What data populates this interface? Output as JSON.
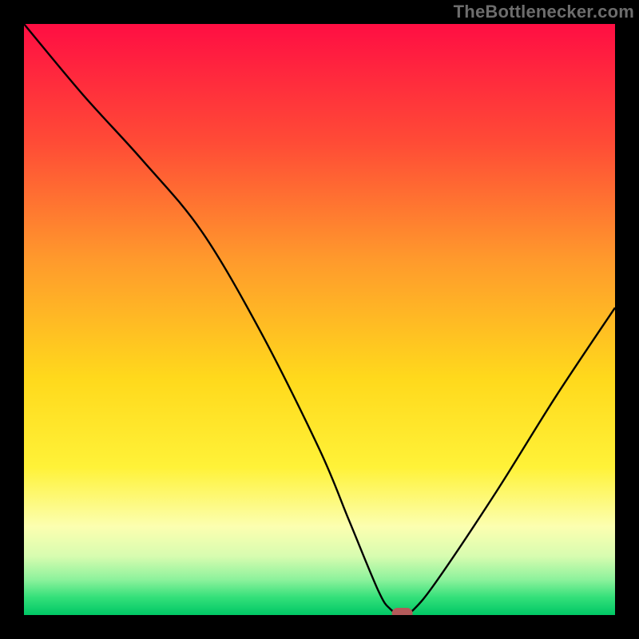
{
  "attribution": "TheBottleneсker.com",
  "chart_data": {
    "type": "line",
    "title": "",
    "xlabel": "",
    "ylabel": "",
    "xlim": [
      0,
      100
    ],
    "ylim": [
      0,
      100
    ],
    "x": [
      0,
      10,
      20,
      30,
      40,
      50,
      55,
      60,
      62,
      64,
      66,
      70,
      80,
      90,
      100
    ],
    "values": [
      100,
      88,
      77,
      65,
      48,
      28,
      16,
      4,
      1,
      0,
      1,
      6,
      21,
      37,
      52
    ],
    "curve_color": "#000000",
    "marker": {
      "x": 64,
      "y": 0,
      "color": "#b45a5a"
    },
    "background_gradient_stops": [
      {
        "pct": 0.0,
        "color": "#ff0e43"
      },
      {
        "pct": 0.2,
        "color": "#ff4b36"
      },
      {
        "pct": 0.4,
        "color": "#ff9a2c"
      },
      {
        "pct": 0.6,
        "color": "#ffd91c"
      },
      {
        "pct": 0.75,
        "color": "#fff238"
      },
      {
        "pct": 0.85,
        "color": "#fcffb0"
      },
      {
        "pct": 0.9,
        "color": "#d8fcb0"
      },
      {
        "pct": 0.94,
        "color": "#8df29c"
      },
      {
        "pct": 0.97,
        "color": "#34e07a"
      },
      {
        "pct": 1.0,
        "color": "#00c765"
      }
    ]
  }
}
